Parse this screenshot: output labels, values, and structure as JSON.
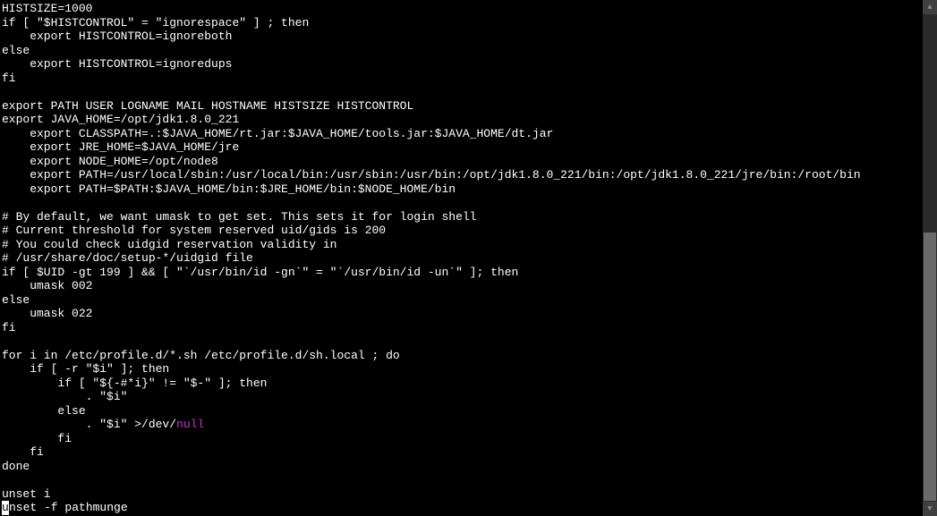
{
  "lines": [
    {
      "text": "HISTSIZE=1000"
    },
    {
      "text": "if [ \"$HISTCONTROL\" = \"ignorespace\" ] ; then"
    },
    {
      "text": "    export HISTCONTROL=ignoreboth"
    },
    {
      "text": "else"
    },
    {
      "text": "    export HISTCONTROL=ignoredups"
    },
    {
      "text": "fi"
    },
    {
      "text": ""
    },
    {
      "text": "export PATH USER LOGNAME MAIL HOSTNAME HISTSIZE HISTCONTROL"
    },
    {
      "text": "export JAVA_HOME=/opt/jdk1.8.0_221"
    },
    {
      "text": "    export CLASSPATH=.:$JAVA_HOME/rt.jar:$JAVA_HOME/tools.jar:$JAVA_HOME/dt.jar"
    },
    {
      "text": "    export JRE_HOME=$JAVA_HOME/jre"
    },
    {
      "text": "    export NODE_HOME=/opt/node8"
    },
    {
      "text": "    export PATH=/usr/local/sbin:/usr/local/bin:/usr/sbin:/usr/bin:/opt/jdk1.8.0_221/bin:/opt/jdk1.8.0_221/jre/bin:/root/bin"
    },
    {
      "text": "    export PATH=$PATH:$JAVA_HOME/bin:$JRE_HOME/bin:$NODE_HOME/bin"
    },
    {
      "text": ""
    },
    {
      "text": "# By default, we want umask to get set. This sets it for login shell"
    },
    {
      "text": "# Current threshold for system reserved uid/gids is 200"
    },
    {
      "text": "# You could check uidgid reservation validity in"
    },
    {
      "text": "# /usr/share/doc/setup-*/uidgid file"
    },
    {
      "text": "if [ $UID -gt 199 ] && [ \"`/usr/bin/id -gn`\" = \"`/usr/bin/id -un`\" ]; then"
    },
    {
      "text": "    umask 002"
    },
    {
      "text": "else"
    },
    {
      "text": "    umask 022"
    },
    {
      "text": "fi"
    },
    {
      "text": ""
    },
    {
      "text": "for i in /etc/profile.d/*.sh /etc/profile.d/sh.local ; do"
    },
    {
      "text": "    if [ -r \"$i\" ]; then"
    },
    {
      "text": "        if [ \"${-#*i}\" != \"$-\" ]; then"
    },
    {
      "text": "            . \"$i\""
    },
    {
      "text": "        else"
    },
    {
      "text": "            . \"$i\" >/dev/",
      "null_suffix": "null"
    },
    {
      "text": "        fi"
    },
    {
      "text": "    fi"
    },
    {
      "text": "done"
    },
    {
      "text": ""
    },
    {
      "text": "unset i"
    },
    {
      "cursor_prefix": "u",
      "text": "nset -f pathmunge"
    }
  ],
  "scrollbar": {
    "up": "▲",
    "down": "▼"
  }
}
